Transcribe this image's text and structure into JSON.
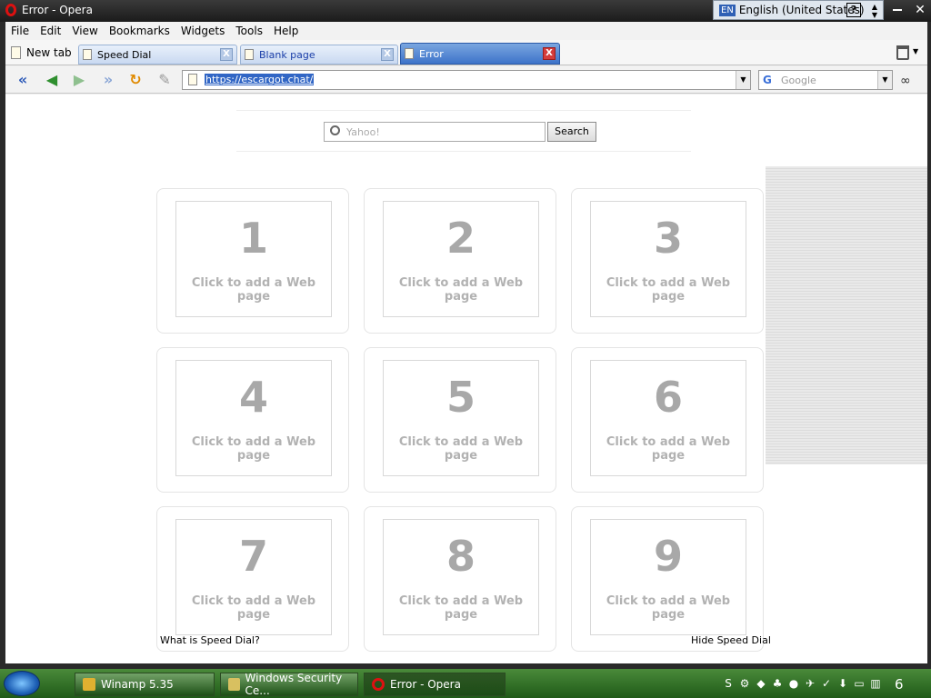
{
  "window": {
    "title": "Error - Opera",
    "language_code": "EN",
    "language_name": "English (United States)",
    "help_label": "?",
    "close_label": "✕"
  },
  "menu": [
    "File",
    "Edit",
    "View",
    "Bookmarks",
    "Widgets",
    "Tools",
    "Help"
  ],
  "tabs": {
    "new_tab_label": "New tab",
    "items": [
      {
        "label": "Speed Dial"
      },
      {
        "label": "Blank page"
      },
      {
        "label": "Error",
        "active": true
      }
    ],
    "close_glyph": "X"
  },
  "address_bar": {
    "url": "https://escargot.chat/",
    "search_engine": "Google",
    "search_placeholder": "Google",
    "icons": [
      "back-start-icon",
      "back-icon",
      "forward-icon",
      "fastforward-icon",
      "reload-icon",
      "edit-icon",
      "glasses-icon"
    ]
  },
  "speed_dial": {
    "search_placeholder": "Yahoo!",
    "search_button": "Search",
    "dials": [
      {
        "number": "1",
        "text": "Click to add a Web page"
      },
      {
        "number": "2",
        "text": "Click to add a Web page"
      },
      {
        "number": "3",
        "text": "Click to add a Web page"
      },
      {
        "number": "4",
        "text": "Click to add a Web page"
      },
      {
        "number": "5",
        "text": "Click to add a Web page"
      },
      {
        "number": "6",
        "text": "Click to add a Web page"
      },
      {
        "number": "7",
        "text": "Click to add a Web page"
      },
      {
        "number": "8",
        "text": "Click to add a Web page"
      },
      {
        "number": "9",
        "text": "Click to add a Web page"
      }
    ],
    "what_is_link": "What is Speed Dial?",
    "hide_link": "Hide Speed Dial"
  },
  "taskbar": {
    "buttons": [
      {
        "label": "Winamp 5.35"
      },
      {
        "label": "Windows Security Ce..."
      },
      {
        "label": "Error - Opera"
      }
    ],
    "clock": "6"
  },
  "colors": {
    "active_tab": "#3d73c9",
    "url_selection": "#3166c5",
    "taskbar": "#2f6f28"
  }
}
